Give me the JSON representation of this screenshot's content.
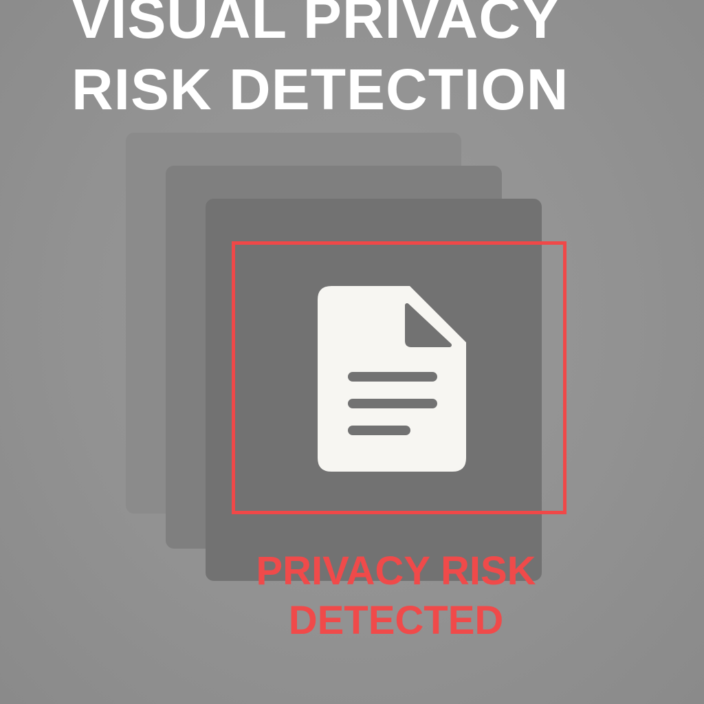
{
  "title": {
    "line1": "VISUAL PRIVACY",
    "line2": "RISK DETECTION"
  },
  "alert": {
    "line1": "PRIVACY RISK",
    "line2": "DETECTED"
  },
  "icon": "document-icon",
  "colors": {
    "background": "#929292",
    "title": "#ffffff",
    "accent_red": "#f04848",
    "document": "#f7f6f2",
    "card_back": "#8b8b8b",
    "card_middle": "#7f7f7f",
    "card_front": "#727272"
  }
}
